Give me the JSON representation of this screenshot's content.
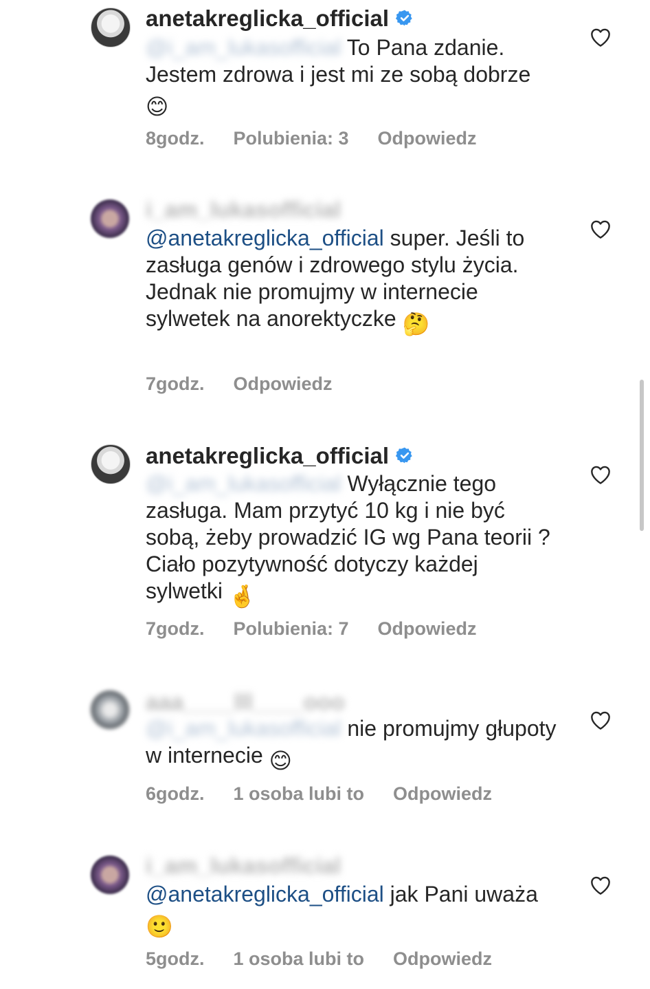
{
  "comments": [
    {
      "username": "anetakreglicka_official",
      "mention": "@i_am_lukasofficial",
      "text": "To Pana zdanie. Jestem zdrowa i jest mi ze sobą dobrze",
      "emoji": "😊",
      "time": "8godz.",
      "likes": "Polubienia: 3",
      "reply": "Odpowiedz"
    },
    {
      "username": "i_am_lukasofficial",
      "mention": "@anetakreglicka_official",
      "text": "super. Jeśli to zasługa genów i zdrowego stylu życia. Jednak nie promujmy w internecie sylwetek na anorektyczke",
      "emoji": "🤔",
      "time": "7godz.",
      "reply": "Odpowiedz"
    },
    {
      "username": "anetakreglicka_official",
      "mention": "@i_am_lukasofficial",
      "text": "Wyłącznie tego zasługa. Mam przytyć 10 kg i nie być sobą, żeby prowadzić IG wg Pana teorii ?  Ciało pozytywność dotyczy każdej sylwetki",
      "emoji": "🤞",
      "time": "7godz.",
      "likes": "Polubienia: 7",
      "reply": "Odpowiedz"
    },
    {
      "username": "aaa____lll____ooo",
      "mention": "@i_am_lukasofficial",
      "text": "nie promujmy głupoty w internecie",
      "emoji": "😊",
      "time": "6godz.",
      "likes": "1 osoba lubi to",
      "reply": "Odpowiedz"
    },
    {
      "username": "i_am_lukasofficial",
      "mention": "@anetakreglicka_official",
      "text": "jak Pani uważa",
      "emoji": "🙂",
      "time": "5godz.",
      "likes": "1 osoba lubi to",
      "reply": "Odpowiedz"
    }
  ],
  "icons": {
    "verified": "verified-badge-icon",
    "like": "heart-icon"
  },
  "colors": {
    "verified": "#3897f0",
    "mention": "#1d4f85",
    "meta": "#8e8e8e",
    "text": "#262626"
  }
}
